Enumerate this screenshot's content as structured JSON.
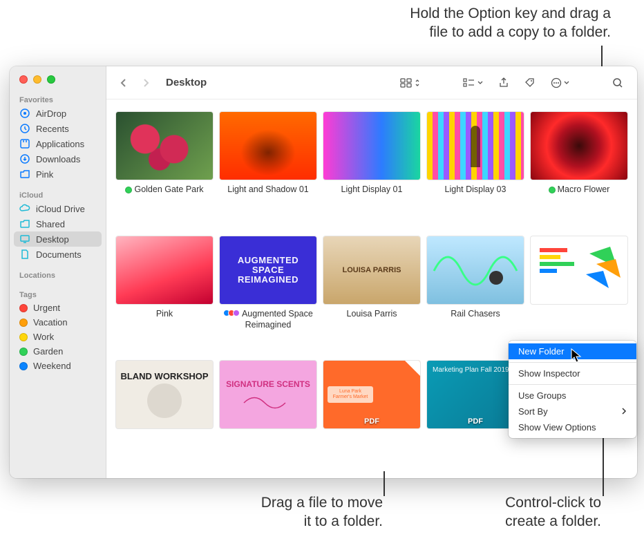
{
  "annotations": {
    "top": "Hold the Option key and drag a\nfile to add a copy to a folder.",
    "bottom_left": "Drag a file to move\nit to a folder.",
    "bottom_right": "Control-click to\ncreate a folder."
  },
  "sidebar": {
    "favorites_title": "Favorites",
    "airdrop": "AirDrop",
    "recents": "Recents",
    "applications": "Applications",
    "downloads": "Downloads",
    "pink": "Pink",
    "icloud_title": "iCloud",
    "icloud_drive": "iCloud Drive",
    "shared": "Shared",
    "desktop": "Desktop",
    "documents": "Documents",
    "locations_title": "Locations",
    "tags_title": "Tags",
    "tags": {
      "urgent": {
        "label": "Urgent",
        "color": "#ff453a"
      },
      "vacation": {
        "label": "Vacation",
        "color": "#ff9f0a"
      },
      "work": {
        "label": "Work",
        "color": "#ffd60a"
      },
      "garden": {
        "label": "Garden",
        "color": "#30d158"
      },
      "weekend": {
        "label": "Weekend",
        "color": "#0a84ff"
      }
    }
  },
  "toolbar": {
    "title": "Desktop"
  },
  "items": [
    {
      "label": "Golden Gate Park",
      "tag": "green"
    },
    {
      "label": "Light and Shadow 01"
    },
    {
      "label": "Light Display 01"
    },
    {
      "label": "Light Display 03"
    },
    {
      "label": "Macro Flower",
      "tag": "green"
    },
    {
      "label": "Pink"
    },
    {
      "label": "Augmented Space Reimagined",
      "multitag": true
    },
    {
      "label": "Louisa Parris"
    },
    {
      "label": "Rail Chasers"
    },
    {
      "label": ""
    },
    {
      "label": ""
    },
    {
      "label": ""
    },
    {
      "label": ""
    },
    {
      "label": ""
    }
  ],
  "thumbs": {
    "t5_text": "AUGMENTED\nSPACE\nREIMAGINED",
    "t6_text": "LOUISA PARRIS",
    "t9_text": "BLAND WORKSHOP",
    "t10_text": "SIGNATURE SCENTS",
    "t11_text": "Luna Park Farmer's Market",
    "t12_text": "Marketing Plan Fall 2019",
    "pdf": "PDF"
  },
  "context_menu": {
    "new_folder": "New Folder",
    "show_inspector": "Show Inspector",
    "use_groups": "Use Groups",
    "sort_by": "Sort By",
    "show_view_options": "Show View Options"
  }
}
